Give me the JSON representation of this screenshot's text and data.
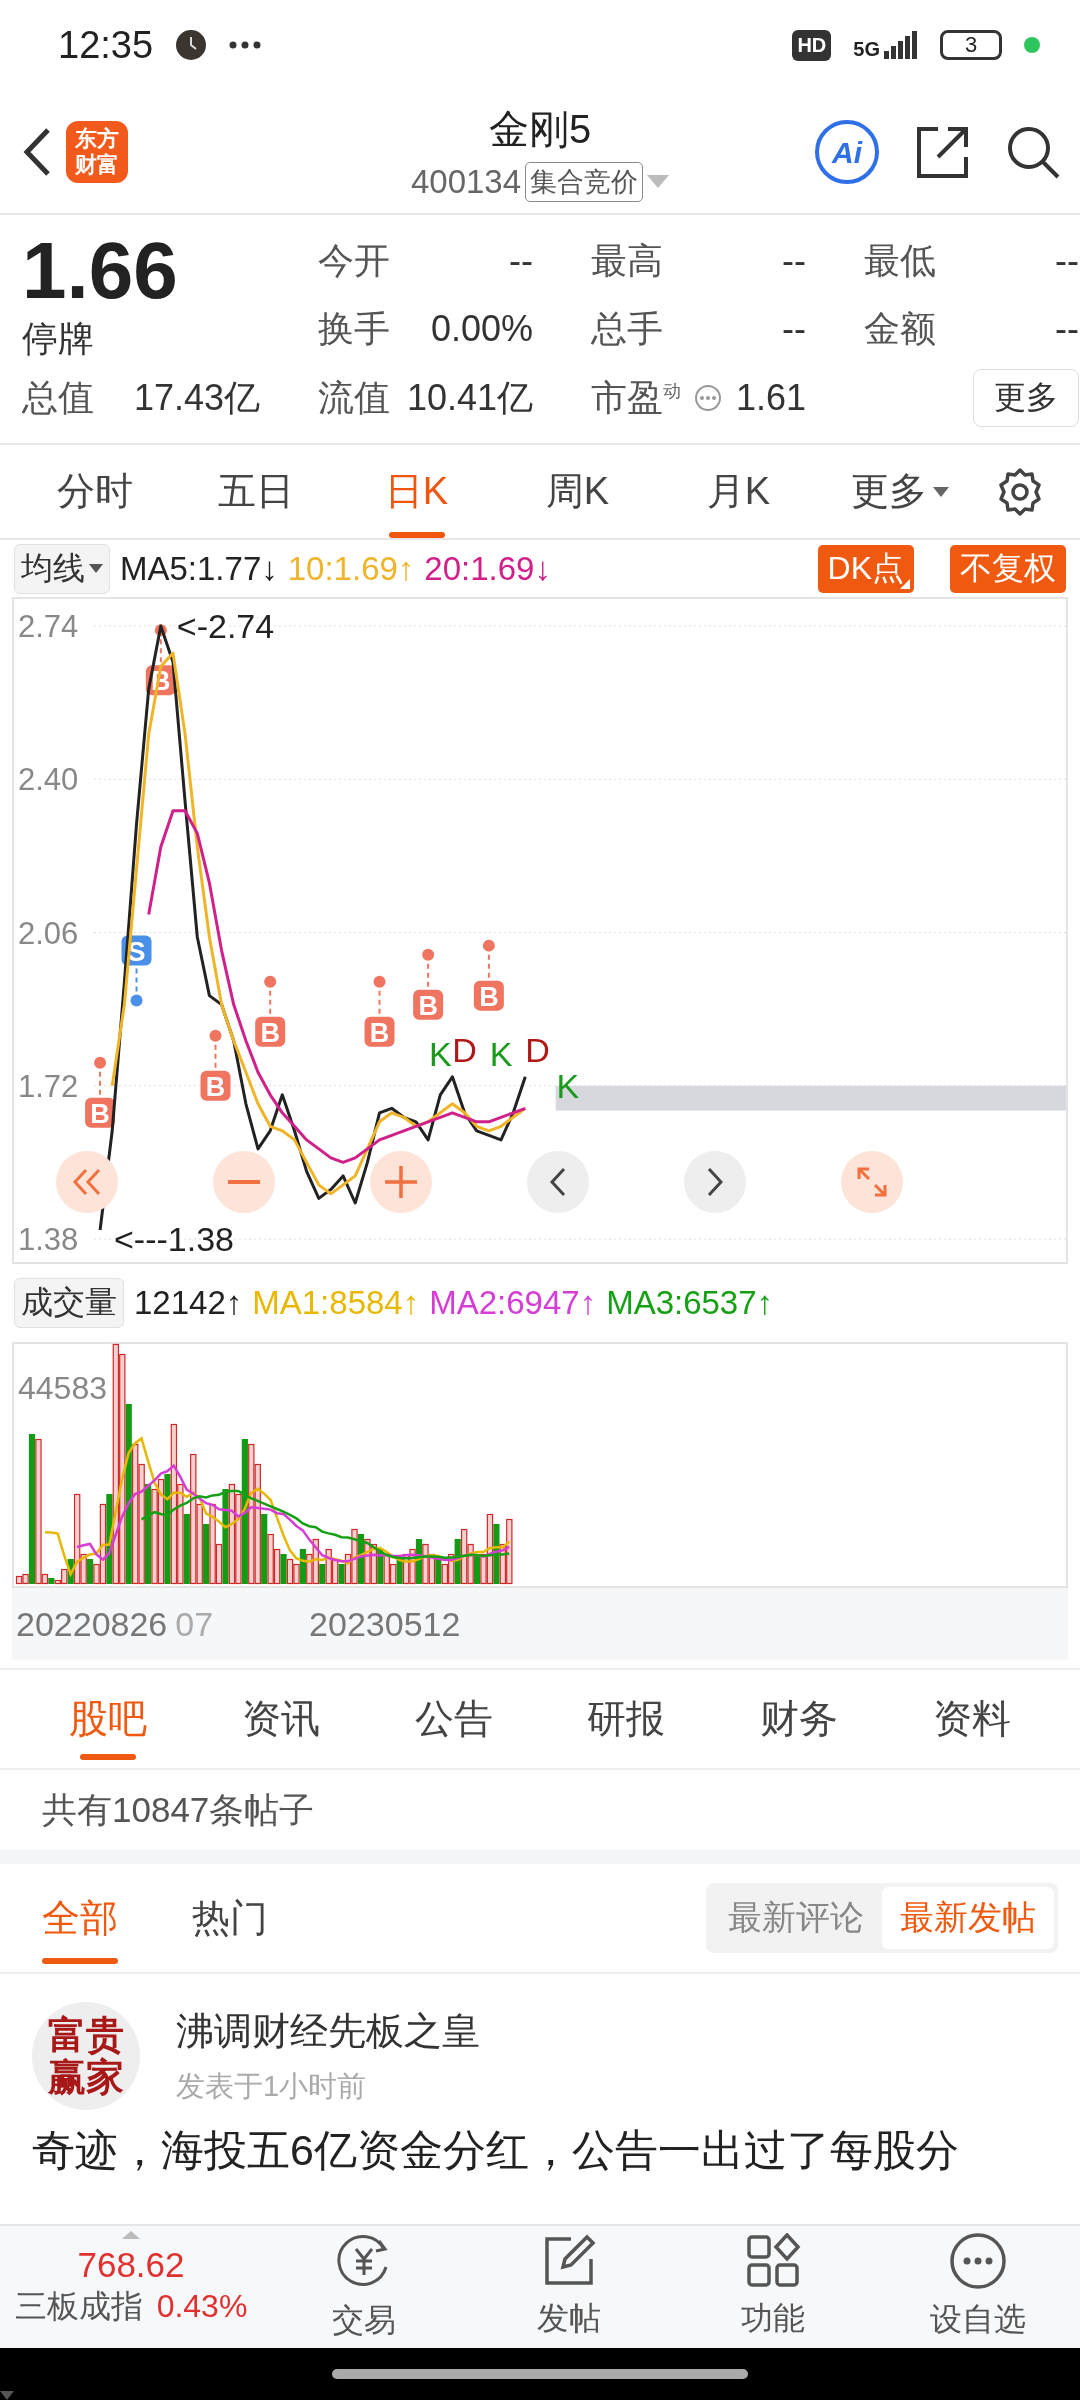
{
  "status_bar": {
    "time": "12:35",
    "hd": "HD",
    "network": "5G",
    "battery": "3"
  },
  "header": {
    "logo_text": "东方财富",
    "title": "金刚5",
    "code": "400134",
    "badge": "集合竞价",
    "ai_label": "Ai"
  },
  "quote": {
    "price": "1.66",
    "status": "停牌",
    "fields": [
      {
        "label": "今开",
        "value": "--"
      },
      {
        "label": "最高",
        "value": "--"
      },
      {
        "label": "最低",
        "value": "--"
      },
      {
        "label": "换手",
        "value": "0.00%"
      },
      {
        "label": "总手",
        "value": "--"
      },
      {
        "label": "金额",
        "value": "--"
      }
    ],
    "summary": [
      {
        "label": "总值",
        "value": "17.43亿"
      },
      {
        "label": "流值",
        "value": "10.41亿"
      },
      {
        "label": "市盈",
        "sup": "动",
        "value": "1.61"
      }
    ],
    "more_button": "更多"
  },
  "period_tabs": [
    {
      "label": "分时",
      "selected": false
    },
    {
      "label": "五日",
      "selected": false
    },
    {
      "label": "日K",
      "selected": true
    },
    {
      "label": "周K",
      "selected": false
    },
    {
      "label": "月K",
      "selected": false
    },
    {
      "label": "更多",
      "selected": false,
      "dropdown": true
    }
  ],
  "price_chart": {
    "selector": "均线",
    "legend_arrows": [
      "↓",
      "↑",
      "↓"
    ],
    "buttons": [
      {
        "label": "DK点",
        "corner": true
      },
      {
        "label": "不复权",
        "corner": false
      }
    ],
    "high_label": "<-2.74",
    "low_label": "<---1.38",
    "markers": [
      {
        "text": "B",
        "kind": "buy"
      },
      {
        "text": "S",
        "kind": "sell"
      },
      {
        "text": "B",
        "kind": "buy"
      },
      {
        "text": "B",
        "kind": "buy"
      },
      {
        "text": "B",
        "kind": "buy"
      },
      {
        "text": "B",
        "kind": "buy"
      },
      {
        "text": "B",
        "kind": "buy"
      },
      {
        "text": "B",
        "kind": "buy"
      },
      {
        "text": "K",
        "kind": "k"
      },
      {
        "text": "D",
        "kind": "d"
      },
      {
        "text": "K",
        "kind": "k"
      },
      {
        "text": "D",
        "kind": "d"
      },
      {
        "text": "K",
        "kind": "k"
      }
    ],
    "chart_data": {
      "type": "line",
      "categories": [
        null,
        null,
        null,
        null,
        null,
        null,
        null,
        null,
        null,
        null,
        null,
        null,
        null,
        null,
        null,
        null,
        null,
        null,
        null,
        null,
        null,
        null,
        null,
        null,
        null,
        null,
        null,
        null,
        null,
        null,
        null,
        null,
        null,
        null,
        null,
        null,
        null,
        null,
        null,
        null,
        null,
        null,
        null,
        null,
        null,
        null,
        null,
        null,
        null,
        null,
        null,
        null,
        null,
        null,
        null,
        null,
        null,
        null,
        null,
        null,
        null,
        null,
        null,
        null,
        null,
        null,
        null,
        null,
        null,
        null,
        null,
        null,
        null,
        null,
        null,
        null,
        null,
        null,
        null,
        null
      ],
      "ylim": [
        1.329,
        2.8
      ],
      "grid": true,
      "bands": [
        {
          "axis": "y",
          "from": 1.665,
          "to": 1.72
        }
      ],
      "yticks": [
        {
          "value": 2.74,
          "label": "2.74"
        },
        {
          "value": 2.4,
          "label": "2.40"
        },
        {
          "value": 2.06,
          "label": "2.06"
        },
        {
          "value": 1.72,
          "label": "1.72"
        },
        {
          "value": 1.38,
          "label": "1.38"
        }
      ],
      "series": [
        {
          "name": "MA5:1.77",
          "color": "#222222",
          "values": [
            1.4,
            1.62,
            1.95,
            2.3,
            2.6,
            2.74,
            2.66,
            2.35,
            2.05,
            1.92,
            1.9,
            1.82,
            1.68,
            1.58,
            1.62,
            1.7,
            1.62,
            1.53,
            1.47,
            1.49,
            1.52,
            1.46,
            1.55,
            1.66,
            1.67,
            1.65,
            1.64,
            1.6,
            1.7,
            1.74,
            1.66,
            1.62,
            1.61,
            1.6,
            1.66,
            1.74,
            null,
            null,
            null,
            null,
            null,
            null,
            null,
            null,
            null,
            null,
            null,
            null,
            null,
            null,
            null,
            null,
            null,
            null,
            null,
            null,
            null,
            null,
            null,
            null,
            null,
            null,
            null,
            null,
            null,
            null,
            null,
            null,
            null,
            null,
            null,
            null,
            null,
            null,
            null,
            null,
            null,
            null,
            null,
            null
          ]
        },
        {
          "name": "10:1.69",
          "color": "#f0b429",
          "values": [
            null,
            1.72,
            1.9,
            2.2,
            2.5,
            2.65,
            2.68,
            2.5,
            2.25,
            2.05,
            1.9,
            1.82,
            1.75,
            1.68,
            1.63,
            1.62,
            1.6,
            1.55,
            1.5,
            1.48,
            1.5,
            1.52,
            1.58,
            1.64,
            1.66,
            1.65,
            1.63,
            1.64,
            1.66,
            1.68,
            1.66,
            1.63,
            1.62,
            1.63,
            1.65,
            1.67,
            null,
            null,
            null,
            null,
            null,
            null,
            null,
            null,
            null,
            null,
            null,
            null,
            null,
            null,
            null,
            null,
            null,
            null,
            null,
            null,
            null,
            null,
            null,
            null,
            null,
            null,
            null,
            null,
            null,
            null,
            null,
            null,
            null,
            null,
            null,
            null,
            null,
            null,
            null,
            null,
            null,
            null,
            null,
            null
          ]
        },
        {
          "name": "20:1.69",
          "color": "#d0208a",
          "values": [
            null,
            null,
            null,
            null,
            2.1,
            2.25,
            2.33,
            2.33,
            2.28,
            2.17,
            2.02,
            1.9,
            1.82,
            1.75,
            1.7,
            1.66,
            1.63,
            1.6,
            1.58,
            1.56,
            1.55,
            1.56,
            1.58,
            1.6,
            1.61,
            1.62,
            1.63,
            1.64,
            1.65,
            1.66,
            1.65,
            1.64,
            1.64,
            1.65,
            1.66,
            1.67,
            null,
            null,
            null,
            null,
            null,
            null,
            null,
            null,
            null,
            null,
            null,
            null,
            null,
            null,
            null,
            null,
            null,
            null,
            null,
            null,
            null,
            null,
            null,
            null,
            null,
            null,
            null,
            null,
            null,
            null,
            null,
            null,
            null,
            null,
            null,
            null,
            null,
            null,
            null,
            null,
            null,
            null,
            null,
            null
          ]
        }
      ]
    }
  },
  "volume_chart": {
    "selector": "成交量",
    "value": "12142",
    "arrow": "↑",
    "legend": [
      {
        "text": "MA1:8584",
        "arrow": "↑",
        "color": "#e8b800"
      },
      {
        "text": "MA2:6947",
        "arrow": "↑",
        "color": "#d63cd6"
      },
      {
        "text": "MA3:6537",
        "arrow": "↑",
        "color": "#16a016"
      }
    ],
    "max_label": "44583",
    "dates": [
      "20220826",
      "07",
      "20230512"
    ]
  },
  "forum": {
    "tabs": [
      {
        "label": "股吧",
        "selected": true
      },
      {
        "label": "资讯",
        "selected": false
      },
      {
        "label": "公告",
        "selected": false
      },
      {
        "label": "研报",
        "selected": false
      },
      {
        "label": "财务",
        "selected": false
      },
      {
        "label": "资料",
        "selected": false
      }
    ],
    "count_text": "共有10847条帖子",
    "sub_tabs": [
      {
        "label": "全部",
        "selected": true
      },
      {
        "label": "热门",
        "selected": false
      }
    ],
    "sort": [
      {
        "label": "最新评论",
        "selected": false
      },
      {
        "label": "最新发帖",
        "selected": true
      }
    ],
    "posts": [
      {
        "avatar_text": "富贵赢家",
        "author": "沸调财经先板之皇",
        "time": "发表于1小时前",
        "content": "奇迹，海投五6亿资金分红，公告一出过了每股分"
      }
    ]
  },
  "bottom_bar": {
    "index": {
      "value": "768.62",
      "name": "三板成指",
      "change": "0.43%"
    },
    "nav": [
      {
        "label": "交易",
        "kind": "trade"
      },
      {
        "label": "发帖",
        "kind": "post"
      },
      {
        "label": "功能",
        "kind": "grid"
      },
      {
        "label": "设自选",
        "kind": "more"
      }
    ]
  }
}
